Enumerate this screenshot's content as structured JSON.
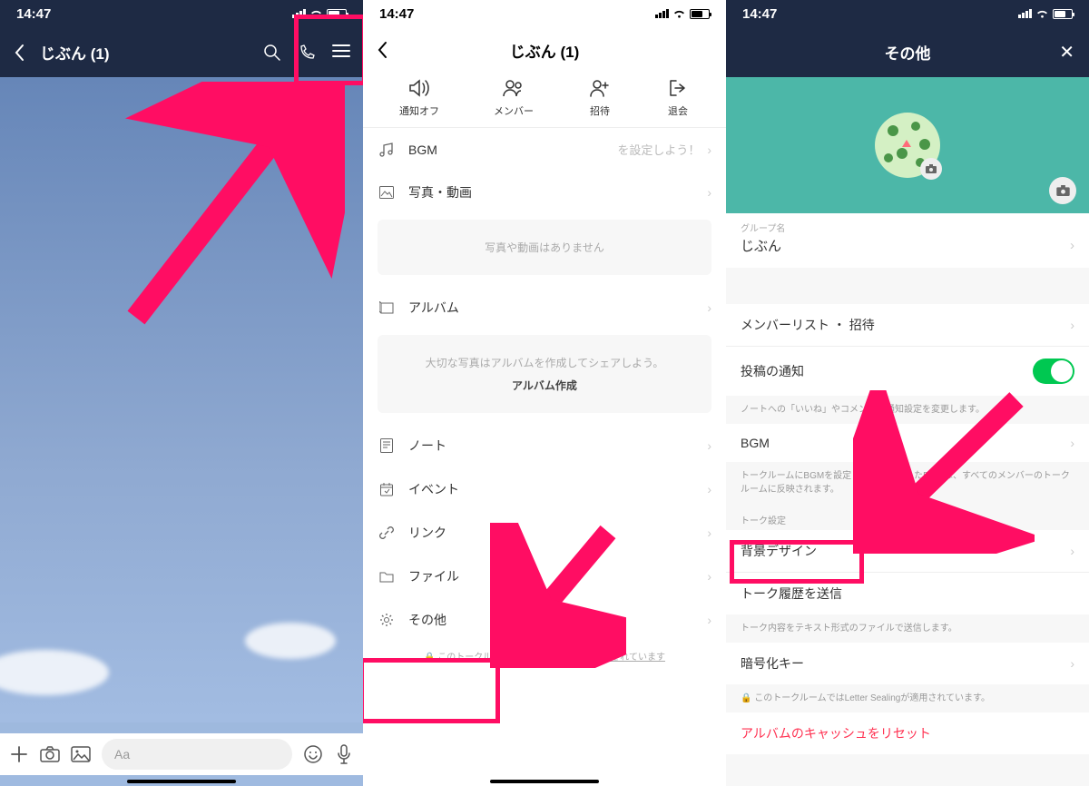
{
  "time": "14:47",
  "highlight_color": "#ff0d63",
  "screen1": {
    "title": "じぶん (1)",
    "input_placeholder": "Aa"
  },
  "screen2": {
    "title": "じぶん (1)",
    "actions": {
      "notify_off": "通知オフ",
      "members": "メンバー",
      "invite": "招待",
      "leave": "退会"
    },
    "bgm": {
      "label": "BGM",
      "hint": "を設定しよう！"
    },
    "photos": {
      "label": "写真・動画",
      "empty": "写真や動画はありません"
    },
    "album": {
      "label": "アルバム",
      "empty1": "大切な写真はアルバムを作成してシェアしよう。",
      "empty2": "アルバム作成"
    },
    "note": "ノート",
    "event": "イベント",
    "link": "リンク",
    "file": "ファイル",
    "other": "その他",
    "footnote": "このトークルームではLetter Sealingが適用されています"
  },
  "screen3": {
    "title": "その他",
    "group_label": "グループ名",
    "group_name": "じぶん",
    "member_list": "メンバーリスト ・ 招待",
    "post_notify": "投稿の通知",
    "post_notify_hint": "ノートへの「いいね」やコメントの通知設定を変更します。",
    "bgm": "BGM",
    "bgm_hint": "トークルームにBGMを設定します。設定したBGMは、すべてのメンバーのトークルームに反映されます。",
    "talk_settings": "トーク設定",
    "bg_design": "背景デザイン",
    "send_history": "トーク履歴を送信",
    "send_history_hint": "トーク内容をテキスト形式のファイルで送信します。",
    "encryption": "暗号化キー",
    "encryption_hint": "このトークルームではLetter Sealingが適用されています。",
    "reset_cache": "アルバムのキャッシュをリセット"
  }
}
